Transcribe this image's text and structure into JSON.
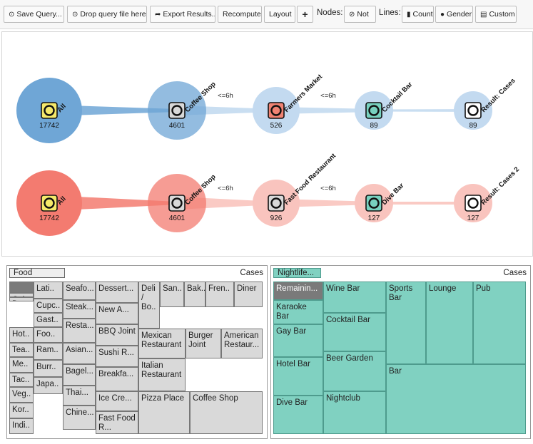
{
  "toolbar": {
    "save_query": "Save Query...",
    "drop_query": "Drop query file here!",
    "export_results": "Export Results...",
    "recompute": "Recompute",
    "layout": "Layout",
    "add": "+",
    "nodes_label": "Nodes:",
    "not_label": "Not",
    "lines_label": "Lines:",
    "count_label": "Count",
    "gender_label": "Gender",
    "custom_label": "Custom"
  },
  "flows": [
    {
      "color": "#6fa6d6",
      "light": "#c3daf0",
      "nodes": [
        {
          "label": "All",
          "count": "17742",
          "ring": "#f5e96a"
        },
        {
          "label": "Coffee Shop",
          "count": "4601",
          "ring": "#d8d8d8"
        },
        {
          "label": "Farmers Market",
          "count": "526",
          "ring": "#f08373"
        },
        {
          "label": "Cocktail Bar",
          "count": "89",
          "ring": "#78d1bf"
        },
        {
          "label": "Result: Cases",
          "count": "89",
          "ring": "#ffffff"
        }
      ],
      "gaps": [
        "<=6h",
        "<=6h"
      ]
    },
    {
      "color": "#f37b70",
      "light": "#f9c4be",
      "nodes": [
        {
          "label": "All",
          "count": "17742",
          "ring": "#f5e96a"
        },
        {
          "label": "Coffee Shop",
          "count": "4601",
          "ring": "#d8d8d8"
        },
        {
          "label": "Fast Food Restaurant",
          "count": "926",
          "ring": "#d8d8d8"
        },
        {
          "label": "Dive Bar",
          "count": "127",
          "ring": "#78d1bf"
        },
        {
          "label": "Result: Cases 2",
          "count": "127",
          "ring": "#ffffff"
        }
      ],
      "gaps": [
        "<=6h",
        "<=6h"
      ]
    }
  ],
  "food": {
    "tab": "Food",
    "cases": "Cases",
    "cells": [
      "",
      "Lati..",
      "Cuba..",
      "Donu..",
      "Cupc..",
      "Gast..",
      "Foo..",
      "Ram..",
      "Burr..",
      "Japa..",
      "Hot..",
      "Tea..",
      "Me..",
      "Tac..",
      "Veg..",
      "Kor..",
      "Indi..",
      "Seafo...",
      "Steak...",
      "Resta...",
      "Asian...",
      "Bagel...",
      "Thai...",
      "Chine...",
      "Dessert...",
      "New A...",
      "BBQ Joint",
      "Sushi R...",
      "Breakfa...",
      "Ice Cre...",
      "Fast Food R...",
      "Deli / Bo..",
      "San..",
      "Bak..",
      "Fren..",
      "Diner",
      "Mexican Restaurant",
      "Burger Joint",
      "American Restaur...",
      "Italian Restaurant",
      "Pizza Place",
      "Coffee Shop"
    ]
  },
  "nightlife": {
    "tab": "Nightlife...",
    "cases": "Cases",
    "cells": [
      "Remainin...",
      "Karaoke Bar",
      "Gay Bar",
      "Hotel Bar",
      "Dive Bar",
      "Wine Bar",
      "Cocktail Bar",
      "Beer Garden",
      "Nightclub",
      "Sports Bar",
      "Lounge",
      "Pub",
      "Bar"
    ]
  }
}
